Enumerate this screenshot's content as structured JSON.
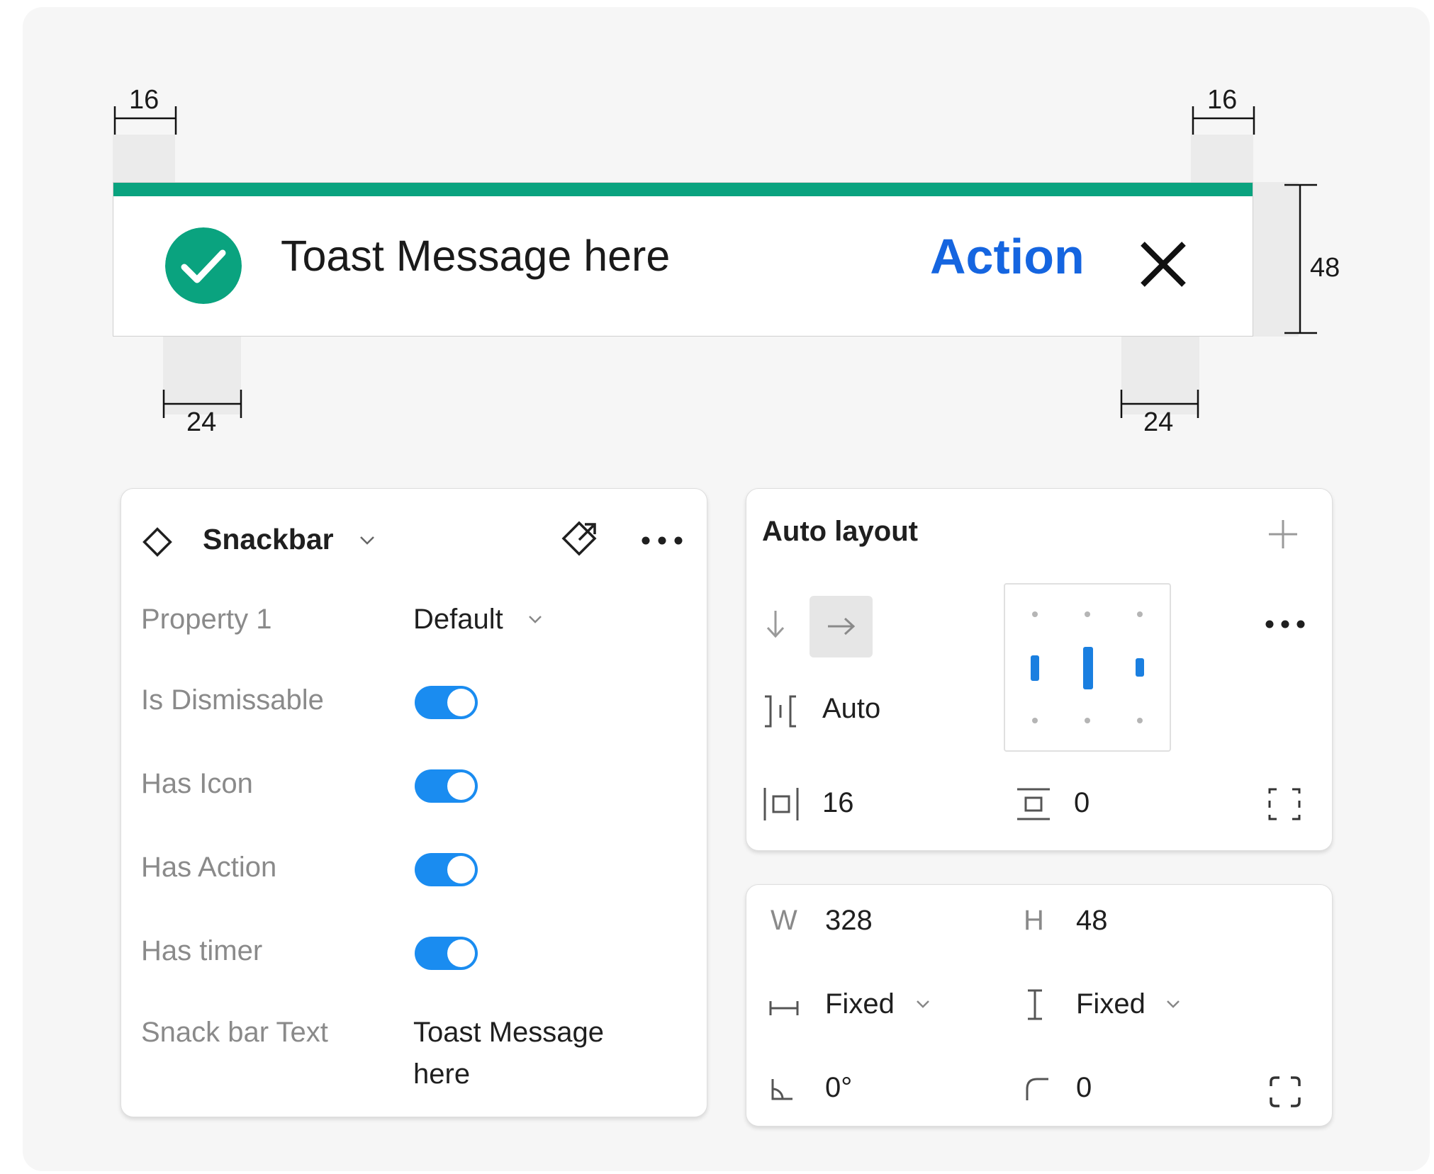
{
  "colors": {
    "toast_bar": "#0aa37f",
    "check_fill": "#0aa37f",
    "action_text": "#1565e0",
    "toggle_on": "#1a8cf0",
    "layout_bar": "#1a7fe0"
  },
  "spec": {
    "dim_left_margin": "16",
    "dim_right_margin": "16",
    "dim_left_padding": "24",
    "dim_right_padding": "24",
    "dim_height": "48"
  },
  "toast": {
    "icon": "check-circle-icon",
    "message": "Toast Message here",
    "action_label": "Action",
    "close_icon": "close-icon"
  },
  "component_panel": {
    "title": "Snackbar",
    "component_icon": "component-diamond-icon",
    "go_to_main_icon": "go-to-main-component-icon",
    "more_icon": "more-icon",
    "properties": [
      {
        "label": "Property 1",
        "value": "Default"
      },
      {
        "label": "Is Dismissable",
        "on": true
      },
      {
        "label": "Has Icon",
        "on": true
      },
      {
        "label": "Has Action",
        "on": true
      },
      {
        "label": "Has timer",
        "on": true
      },
      {
        "label": "Snack bar Text",
        "value_line1": "Toast Message",
        "value_line2": "here"
      }
    ]
  },
  "auto_layout": {
    "title": "Auto layout",
    "gap_label": "Auto",
    "horizontal_padding": "16",
    "vertical_padding": "0"
  },
  "dimensions_panel": {
    "w_label": "W",
    "w_value": "328",
    "h_label": "H",
    "h_value": "48",
    "width_mode": "Fixed",
    "height_mode": "Fixed",
    "rotation": "0°",
    "corner_radius": "0"
  }
}
